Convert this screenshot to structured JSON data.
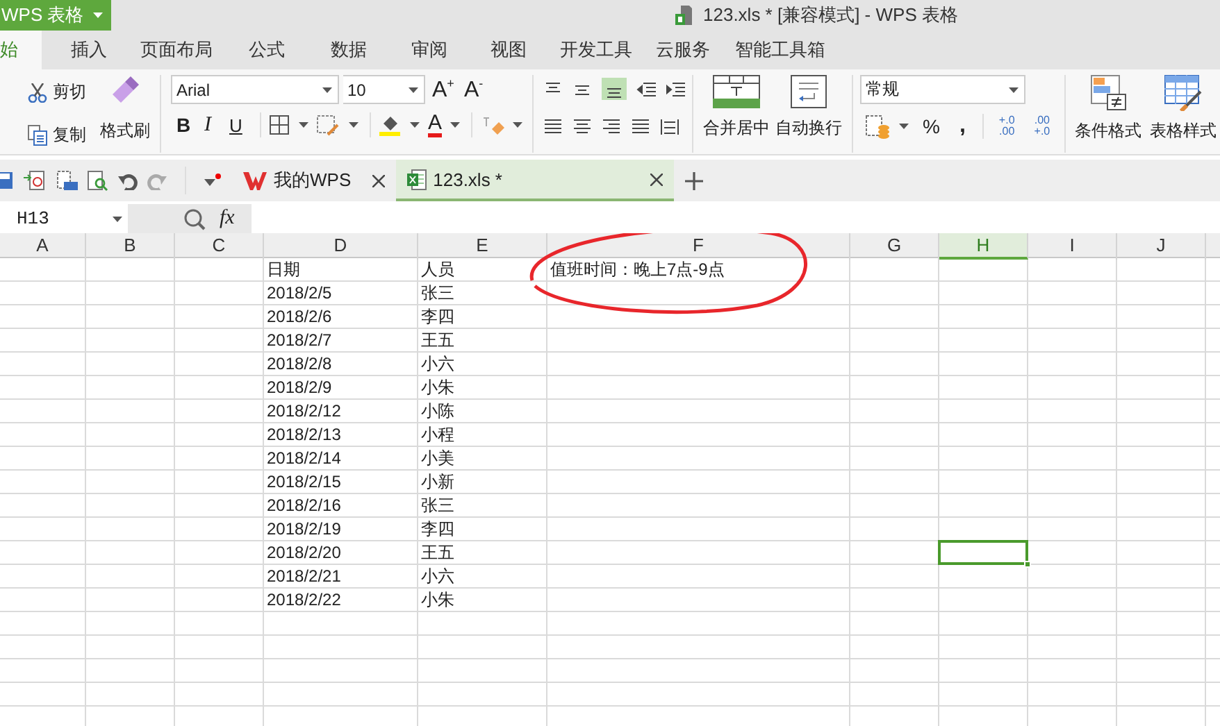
{
  "app_button": {
    "label": "WPS 表格"
  },
  "window_title": "123.xls * [兼容模式] - WPS 表格",
  "ribbon_tabs": [
    {
      "label": "始",
      "selected": true
    },
    {
      "label": "插入",
      "selected": false
    },
    {
      "label": "页面布局",
      "selected": false
    },
    {
      "label": "公式",
      "selected": false
    },
    {
      "label": "数据",
      "selected": false
    },
    {
      "label": "审阅",
      "selected": false
    },
    {
      "label": "视图",
      "selected": false
    },
    {
      "label": "开发工具",
      "selected": false
    },
    {
      "label": "云服务",
      "selected": false
    },
    {
      "label": "智能工具箱",
      "selected": false
    }
  ],
  "ribbon": {
    "cut": "剪切",
    "copy": "复制",
    "format_painter": "格式刷",
    "font": "Arial",
    "font_size": "10",
    "grow": "A$^{+}$",
    "shrink": "A$^{-}$",
    "bold": "B",
    "italic": "I",
    "underline": "U",
    "font_color": "A",
    "merge": "合并居中",
    "wrap": "自动换行",
    "number_format": "常规",
    "percent": "%",
    "comma": ",",
    "decimal_add": [
      "+.0",
      ".00"
    ],
    "decimal_remove": [
      ".00",
      "+.0"
    ],
    "cond_format": "条件格式",
    "table_style": "表格样式"
  },
  "doc_tabs": [
    {
      "label": "我的WPS",
      "selected": false
    },
    {
      "label": "123.xls *",
      "selected": true
    }
  ],
  "name_box": "H13",
  "fx": "fx",
  "columns": [
    {
      "label": "A",
      "selected": false
    },
    {
      "label": "B",
      "selected": false
    },
    {
      "label": "C",
      "selected": false
    },
    {
      "label": "D",
      "selected": false
    },
    {
      "label": "E",
      "selected": false
    },
    {
      "label": "F",
      "selected": false
    },
    {
      "label": "G",
      "selected": false
    },
    {
      "label": "H",
      "selected": true
    },
    {
      "label": "I",
      "selected": false
    },
    {
      "label": "J",
      "selected": false
    }
  ],
  "rows": [
    {
      "selected": false,
      "cells": {
        "D": "日期",
        "E": "人员",
        "F": "值班时间：晚上7点-9点"
      }
    },
    {
      "selected": false,
      "cells": {
        "D": "2018/2/5",
        "E": "张三"
      }
    },
    {
      "selected": false,
      "cells": {
        "D": "2018/2/6",
        "E": "李四"
      }
    },
    {
      "selected": false,
      "cells": {
        "D": "2018/2/7",
        "E": "王五"
      }
    },
    {
      "selected": false,
      "cells": {
        "D": "2018/2/8",
        "E": "小六"
      }
    },
    {
      "selected": false,
      "cells": {
        "D": "2018/2/9",
        "E": "小朱"
      }
    },
    {
      "selected": false,
      "cells": {
        "D": "2018/2/12",
        "E": "小陈"
      }
    },
    {
      "selected": false,
      "cells": {
        "D": "2018/2/13",
        "E": "小程"
      }
    },
    {
      "selected": false,
      "cells": {
        "D": "2018/2/14",
        "E": "小美"
      }
    },
    {
      "selected": false,
      "cells": {
        "D": "2018/2/15",
        "E": "小新"
      }
    },
    {
      "selected": false,
      "cells": {
        "D": "2018/2/16",
        "E": "张三"
      }
    },
    {
      "selected": false,
      "cells": {
        "D": "2018/2/19",
        "E": "李四"
      }
    },
    {
      "selected": true,
      "cells": {
        "D": "2018/2/20",
        "E": "王五"
      }
    },
    {
      "selected": false,
      "cells": {
        "D": "2018/2/21",
        "E": "小六"
      }
    },
    {
      "selected": false,
      "cells": {
        "D": "2018/2/22",
        "E": "小朱"
      }
    },
    {
      "selected": false
    },
    {
      "selected": false
    },
    {
      "selected": false
    },
    {
      "selected": false
    },
    {
      "selected": false
    }
  ],
  "annotations": [
    {
      "kind": "ellipse"
    }
  ]
}
